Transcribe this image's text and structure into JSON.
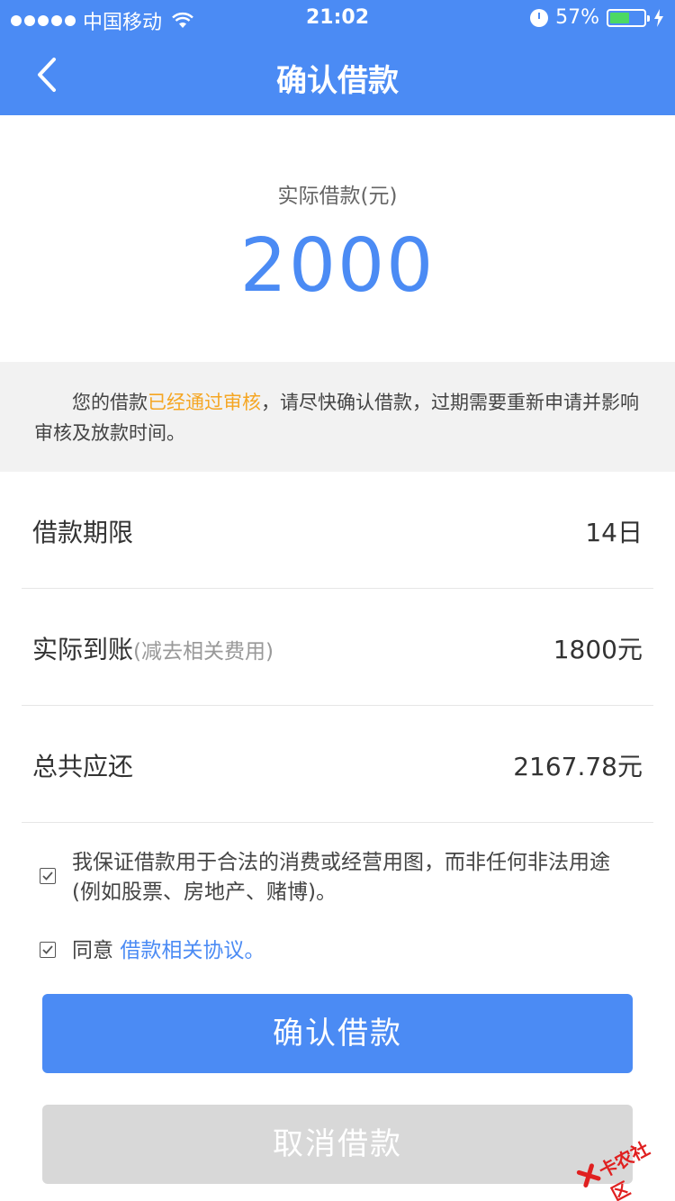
{
  "status_bar": {
    "carrier": "中国移动",
    "time": "21:02",
    "battery": "57%",
    "battery_level": 0.57,
    "icons": [
      "signal-dots",
      "wifi-icon",
      "alarm-icon",
      "battery-icon",
      "charging-bolt-icon"
    ]
  },
  "nav": {
    "title": "确认借款",
    "back_icon": "chevron-left-icon"
  },
  "amount": {
    "label": "实际借款(元)",
    "value": "2000"
  },
  "notice": {
    "before": "您的借款",
    "highlight": "已经通过审核",
    "after": "，请尽快确认借款，过期需要重新申请并影响审核及放款时间。"
  },
  "rows": [
    {
      "label": "借款期限",
      "sub": "",
      "value": "14日"
    },
    {
      "label": "实际到账",
      "sub": "(减去相关费用)",
      "value": "1800元"
    },
    {
      "label": "总共应还",
      "sub": "",
      "value": "2167.78元"
    }
  ],
  "agreements": {
    "guarantee": "我保证借款用于合法的消费或经营用图，而非任何非法用途(例如股票、房地产、赌博)。",
    "agree_prefix": "同意 ",
    "agree_link": "借款相关协议。"
  },
  "buttons": {
    "confirm": "确认借款",
    "cancel": "取消借款"
  },
  "watermark": "卡农社区",
  "colors": {
    "primary": "#4b8bf4",
    "highlight": "#f5a623",
    "battery": "#4cd964",
    "disabled": "#d8d8d8"
  }
}
